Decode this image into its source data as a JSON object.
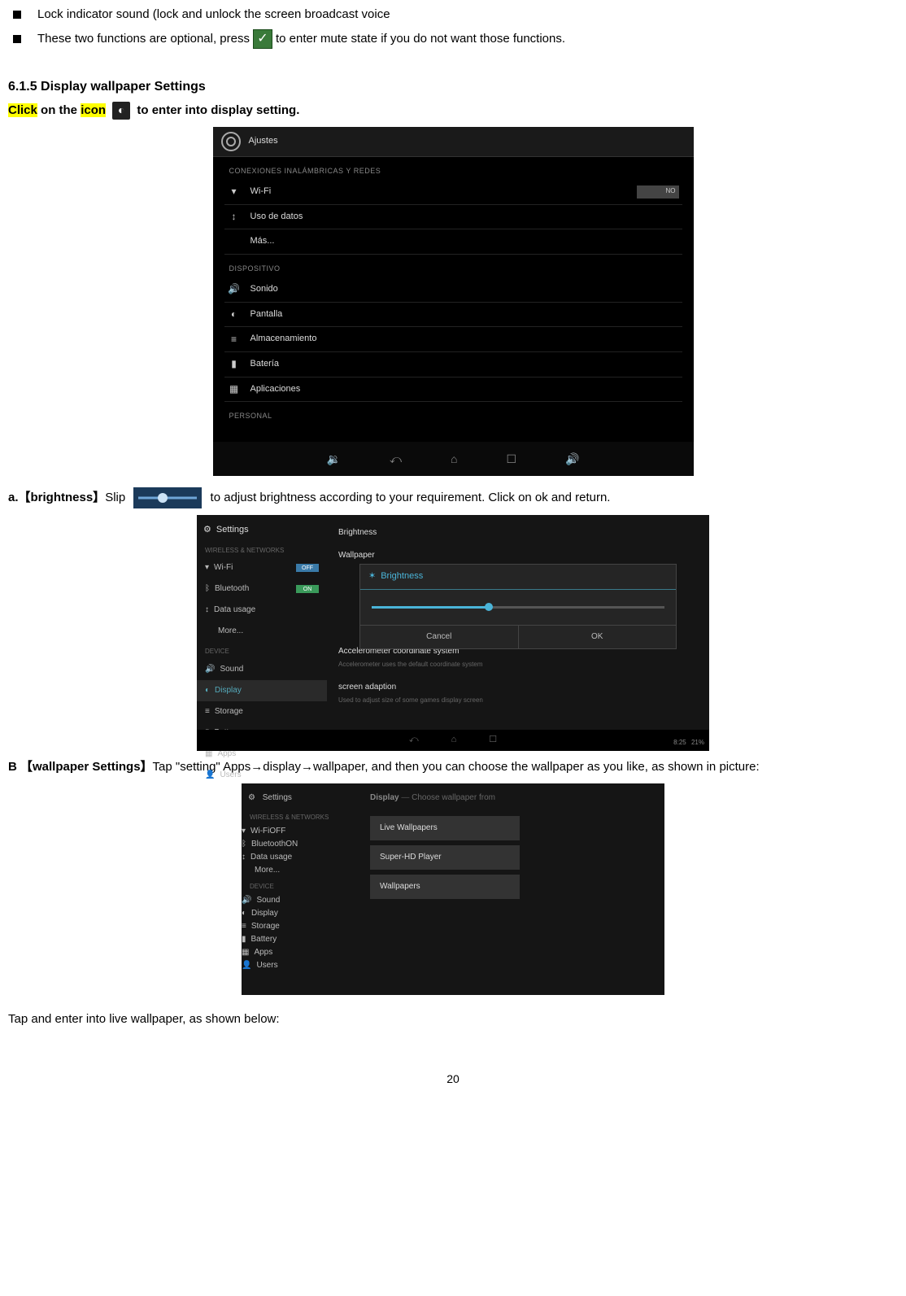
{
  "bullets": {
    "b1": "Lock indicator sound (lock and unlock the screen broadcast voice",
    "b2a": "These two functions are optional, press",
    "b2b": "to enter mute state if you do not want those functions."
  },
  "section_heading": "6.1.5 Display wallpaper Settings",
  "click_line": {
    "click": "Click",
    "on_the": " on the ",
    "icon": "icon",
    "rest": " to enter into display setting."
  },
  "shot1": {
    "title": "Ajustes",
    "cat1": "CONEXIONES INALÁMBRICAS Y REDES",
    "wifi": "Wi-Fi",
    "wifi_toggle": "NO",
    "data": "Uso de datos",
    "mas": "Más...",
    "cat2": "DISPOSITIVO",
    "sonido": "Sonido",
    "pantalla": "Pantalla",
    "almacen": "Almacenamiento",
    "bateria": "Batería",
    "apps": "Aplicaciones",
    "cat3": "PERSONAL"
  },
  "line_a": {
    "prefix": "a.【brightness】",
    "slip": "Slip",
    "rest": "to adjust brightness according to your requirement. Click on ok and return."
  },
  "shot2": {
    "title": "Settings",
    "cat1": "WIRELESS & NETWORKS",
    "wifi": "Wi-Fi",
    "bt": "Bluetooth",
    "data": "Data usage",
    "more": "More...",
    "cat2": "DEVICE",
    "sound": "Sound",
    "display": "Display",
    "storage": "Storage",
    "battery": "Battery",
    "apps": "Apps",
    "users": "Users",
    "r_brightness": "Brightness",
    "r_wallpaper": "Wallpaper",
    "dlg_title": "Brightness",
    "cancel": "Cancel",
    "ok": "OK",
    "accel": "Accelerometer coordinate system",
    "accel_sub": "Accelerometer uses the default coordinate system",
    "adapt": "screen adaption",
    "adapt_sub": "Used to adjust size of some games display screen",
    "time": "8:25",
    "batt": "21%"
  },
  "line_b": {
    "prefix": "B 【wallpaper Settings】",
    "rest": "Tap \"setting\" Apps→display→wallpaper, and then you can choose the wallpaper as you like, as shown in picture:"
  },
  "shot3": {
    "title": "Settings",
    "cat1": "WIRELESS & NETWORKS",
    "wifi": "Wi-Fi",
    "bt": "Bluetooth",
    "data": "Data usage",
    "more": "More...",
    "cat2": "DEVICE",
    "sound": "Sound",
    "display": "Display",
    "storage": "Storage",
    "battery": "Battery",
    "apps": "Apps",
    "users": "Users",
    "header": "Display",
    "header_sub": "Choose wallpaper from",
    "opt1": "Live Wallpapers",
    "opt2": "Super-HD Player",
    "opt3": "Wallpapers"
  },
  "tap_line": "Tap and enter into live wallpaper, as shown below:",
  "page_number": "20"
}
